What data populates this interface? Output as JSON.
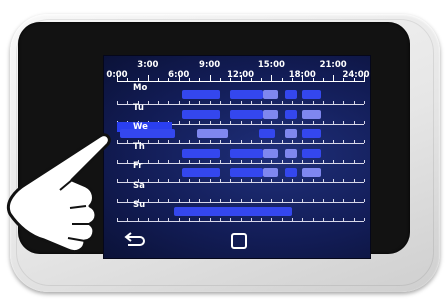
{
  "timeline": {
    "top_labels": [
      "3:00",
      "9:00",
      "15:00",
      "21:00"
    ],
    "bottom_labels": [
      "0:00",
      "6:00",
      "12:00",
      "18:00",
      "24:00"
    ],
    "hours": 24
  },
  "days": [
    {
      "label": "Mo",
      "selected": false,
      "blocks": [
        {
          "start": 6.3,
          "end": 10.0,
          "shade": "dark"
        },
        {
          "start": 11.0,
          "end": 14.2,
          "shade": "dark"
        },
        {
          "start": 14.2,
          "end": 15.6,
          "shade": "light"
        },
        {
          "start": 16.3,
          "end": 17.5,
          "shade": "dark"
        },
        {
          "start": 18.0,
          "end": 19.8,
          "shade": "dark"
        }
      ]
    },
    {
      "label": "Tu",
      "selected": false,
      "blocks": [
        {
          "start": 6.3,
          "end": 10.0,
          "shade": "dark"
        },
        {
          "start": 11.0,
          "end": 14.2,
          "shade": "dark"
        },
        {
          "start": 14.2,
          "end": 15.6,
          "shade": "light"
        },
        {
          "start": 16.3,
          "end": 17.5,
          "shade": "dark"
        },
        {
          "start": 18.0,
          "end": 19.8,
          "shade": "light"
        }
      ]
    },
    {
      "label": "We",
      "selected": true,
      "blocks": [
        {
          "start": 0.3,
          "end": 5.6,
          "shade": "dark"
        },
        {
          "start": 7.8,
          "end": 10.8,
          "shade": "light"
        },
        {
          "start": 13.8,
          "end": 15.4,
          "shade": "dark"
        },
        {
          "start": 16.3,
          "end": 17.5,
          "shade": "light"
        },
        {
          "start": 18.0,
          "end": 19.8,
          "shade": "dark"
        }
      ]
    },
    {
      "label": "Th",
      "selected": false,
      "blocks": [
        {
          "start": 6.3,
          "end": 10.0,
          "shade": "dark"
        },
        {
          "start": 11.0,
          "end": 14.2,
          "shade": "dark"
        },
        {
          "start": 14.2,
          "end": 15.6,
          "shade": "light"
        },
        {
          "start": 16.3,
          "end": 17.5,
          "shade": "light"
        },
        {
          "start": 18.0,
          "end": 19.8,
          "shade": "dark"
        }
      ]
    },
    {
      "label": "Fr",
      "selected": false,
      "blocks": [
        {
          "start": 6.3,
          "end": 10.0,
          "shade": "dark"
        },
        {
          "start": 11.0,
          "end": 14.2,
          "shade": "dark"
        },
        {
          "start": 14.2,
          "end": 15.6,
          "shade": "light"
        },
        {
          "start": 16.3,
          "end": 17.5,
          "shade": "dark"
        },
        {
          "start": 18.0,
          "end": 19.8,
          "shade": "light"
        }
      ]
    },
    {
      "label": "Sa",
      "selected": false,
      "blocks": []
    },
    {
      "label": "Su",
      "selected": false,
      "blocks": [
        {
          "start": 5.5,
          "end": 17.0,
          "shade": "dark"
        }
      ]
    }
  ],
  "icons": {
    "back": "back-arrow-icon",
    "home": "home-square-icon",
    "hand": "pointing-hand-icon"
  },
  "colors": {
    "block_dark": "#3447ee",
    "block_light": "#7f87ef",
    "selected_row": "#2a3ff0",
    "screen": "#1f2f7a"
  }
}
